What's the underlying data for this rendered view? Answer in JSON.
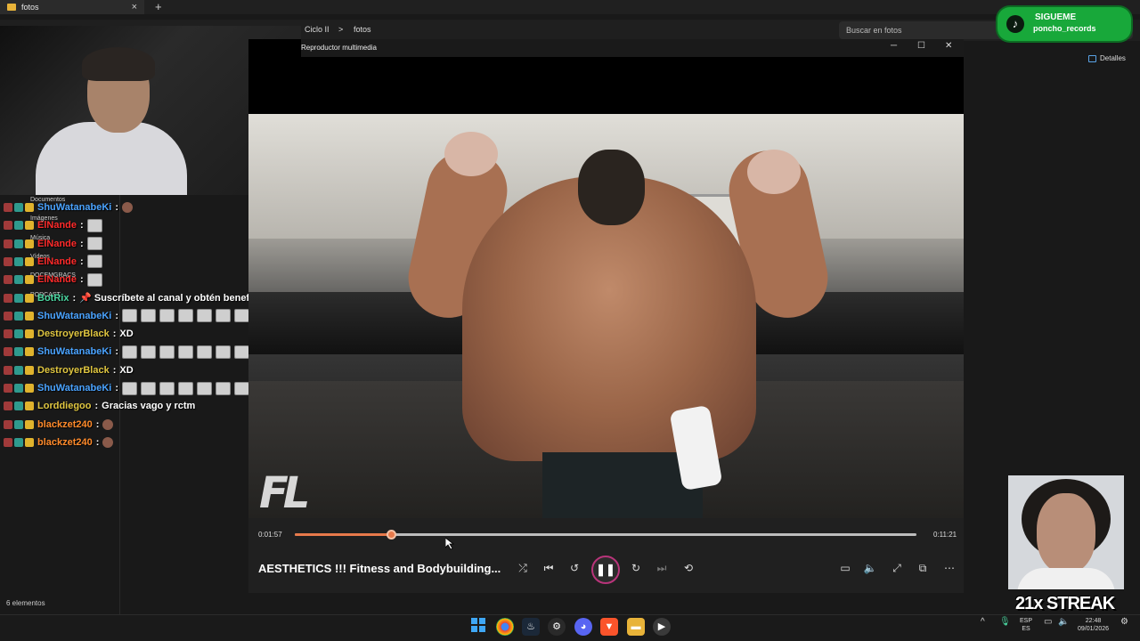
{
  "explorer": {
    "tab_title": "fotos",
    "tab_close": "×",
    "new_tab": "+",
    "breadcrumb": [
      "Ciclo II",
      "fotos"
    ],
    "breadcrumb_sep": ">",
    "search_placeholder": "Buscar en fotos",
    "details_label": "Detalles",
    "sidebar_items": [
      "Documentos",
      "Imágenes",
      "Música",
      "Vídeos",
      "DOCEMGRACS",
      "PODCAST"
    ],
    "status": "6 elementos"
  },
  "tiktok": {
    "title": "SIGUEME",
    "handle": "poncho_records"
  },
  "chat": {
    "messages": [
      {
        "user": "ShuWatanabeKi",
        "color": "#4aa3ff",
        "text": "",
        "emotes": 0,
        "small_emote": true
      },
      {
        "user": "ElNande",
        "color": "#ff2a2a",
        "text": "",
        "emotes": 1
      },
      {
        "user": "ElNande",
        "color": "#ff2a2a",
        "text": "",
        "emotes": 1
      },
      {
        "user": "ElNande",
        "color": "#ff2a2a",
        "text": "",
        "emotes": 1
      },
      {
        "user": "ElNande",
        "color": "#ff2a2a",
        "text": "",
        "emotes": 1
      },
      {
        "user": "BotRix",
        "color": "#4ad6a0",
        "text": "📌 Suscríbete al canal y obtén beneficios exclusivos.✅",
        "emotes": 0
      },
      {
        "user": "ShuWatanabeKi",
        "color": "#4aa3ff",
        "text": "",
        "emotes": 7
      },
      {
        "user": "DestroyerBlack",
        "color": "#e0c640",
        "text": "XD",
        "emotes": 0
      },
      {
        "user": "ShuWatanabeKi",
        "color": "#4aa3ff",
        "text": "",
        "emotes": 7
      },
      {
        "user": "DestroyerBlack",
        "color": "#e0c640",
        "text": "XD",
        "emotes": 0
      },
      {
        "user": "ShuWatanabeKi",
        "color": "#4aa3ff",
        "text": "",
        "emotes": 7
      },
      {
        "user": "Lorddiegoo",
        "color": "#e0c640",
        "text": "Gracias vago y rctm",
        "emotes": 0
      },
      {
        "user": "blackzet240",
        "color": "#ff8a2a",
        "text": "",
        "emotes": 0,
        "small_emote": true
      },
      {
        "user": "blackzet240",
        "color": "#ff8a2a",
        "text": "",
        "emotes": 0,
        "small_emote": true
      }
    ],
    "separator": ":"
  },
  "player": {
    "window_title": "Reproductor multimedia",
    "win_minimize": "─",
    "win_maximize": "☐",
    "win_close": "✕",
    "video_logo": "FL",
    "time_elapsed": "0:01:57",
    "time_total": "0:11:21",
    "progress": 0.155,
    "media_title": "AESTHETICS !!!  Fitness and Bodybuilding...",
    "accent": "#e87a4b",
    "controls": {
      "shuffle": "⤮",
      "previous": "⏮",
      "rewind": "↺",
      "pause": "❚❚",
      "forward": "↻",
      "next": "⏭",
      "repeat": "⟲",
      "subtitles": "▭",
      "volume": "🔈",
      "fullscreen": "⤢",
      "miniplayer": "⧉",
      "more": "⋯"
    }
  },
  "overlay": {
    "streak": "21x STREAK"
  },
  "taskbar": {
    "lang_top": "ESP",
    "lang_bottom": "ES",
    "time": "22:48",
    "date": "09/01/2026",
    "tray_arrow": "^"
  }
}
